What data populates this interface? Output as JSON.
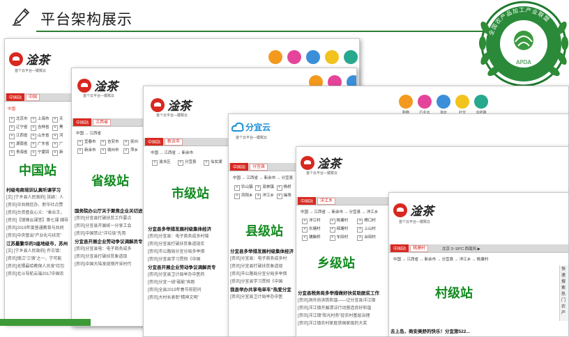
{
  "slide": {
    "title": "平台架构展示"
  },
  "brand": {
    "logo_text": "淦茶",
    "slogan": "首个云平台—键赋云"
  },
  "icon_labels": [
    "购物",
    "行业云",
    "淘云",
    "社交",
    "云终端"
  ],
  "icon_colors": [
    "#f39a1e",
    "#e4459a",
    "#3a8fd8",
    "#f2c31c",
    "#28a88c"
  ],
  "accent": "#d8281f",
  "label_color": "#128a1f",
  "stations": {
    "country": {
      "label": "中国站",
      "tag": "中国站",
      "select": "中国",
      "crumb_chip": "中国",
      "regions": [
        "北京市",
        "上海市",
        "天",
        "辽宁省",
        "吉林省",
        "黑",
        "江西省",
        "山东省",
        "河",
        "湖南省",
        "广东省",
        "广",
        "青海省",
        "宁夏回",
        "新"
      ],
      "news": [
        {
          "t": "h",
          "v": "村级电商培训认真听课学习"
        },
        {
          "t": "i",
          "v": "[文] [宁乡县人民政府] 张颖：人"
        },
        {
          "t": "i",
          "v": "[资讯]中共网信办、新华社点赞"
        },
        {
          "t": "i",
          "v": "[资讯]台资普会心义：“乘业王，"
        },
        {
          "t": "i",
          "v": "[资讯]【镇锋云课堂】第七课 辅导"
        },
        {
          "t": "i",
          "v": "[资讯]2019年度普通教育与共同"
        },
        {
          "t": "i",
          "v": "[资讯]中央管出“产业化与扶贫”"
        },
        {
          "t": "h",
          "v": "江苏最繁华的3座地级市，苏州"
        },
        {
          "t": "i",
          "v": "[文] [宁乡县人民政府] 乔古镇："
        },
        {
          "t": "i",
          "v": "[资讯]镇江“三强”之一，宁可能"
        },
        {
          "t": "i",
          "v": "[资讯]无锡最给教保人员发“红包"
        },
        {
          "t": "i",
          "v": "[资讯]北斗导航云端2017中国农"
        }
      ]
    },
    "province": {
      "label": "省级站",
      "tag": "中国站",
      "select": "江西省",
      "crumb": "中国 → 江西省",
      "regions": [
        "宜春市",
        "吉安市",
        "抚州",
        "新余市",
        "赣州市",
        "萍乡"
      ],
      "news": [
        {
          "t": "h",
          "v": "国务院办公厅关于聚焦企业关切进"
        },
        {
          "t": "i",
          "v": "[资讯]分宜县打破扶贫工作要点"
        },
        {
          "t": "i",
          "v": "[资讯]分宜县开展统一分享工会"
        },
        {
          "t": "i",
          "v": "[资讯]中国禁止“洋垃圾”先用"
        },
        {
          "t": "h",
          "v": "分宜县开展企业劳动争议调解员专"
        },
        {
          "t": "i",
          "v": "[资讯]分宜县电：电子商务成多"
        },
        {
          "t": "i",
          "v": "[资讯]分宜县打破扶贫象道现"
        },
        {
          "t": "i",
          "v": "[资讯]中国大陆发现钢开采时代"
        }
      ]
    },
    "city": {
      "label": "市级站",
      "tag": "中国站",
      "select": "新余市",
      "crumb": "中国 → 江西省 → 新余市",
      "regions": [
        "渝水区",
        "分宜县",
        "仙女湖"
      ],
      "news": [
        {
          "t": "h",
          "v": "分宜县多举措发展村级集体经济"
        },
        {
          "t": "i",
          "v": "[资讯]分宜县：电子商务成多村增"
        },
        {
          "t": "i",
          "v": "[资讯]分宜县打破扶贫象道现实"
        },
        {
          "t": "i",
          "v": "[资讯]市公路局分宜分局多举措"
        },
        {
          "t": "i",
          "v": "[资讯]分宜县学习贯彻《中国"
        },
        {
          "t": "h",
          "v": "分宜县开展企业劳动争议调解员专"
        },
        {
          "t": "i",
          "v": "[资讯]分宜县卫计局举办中医药"
        },
        {
          "t": "i",
          "v": "[资讯]分宜一线“磁能”奔跑"
        },
        {
          "t": "i",
          "v": "[资讯]全县2019年春节前慰问"
        },
        {
          "t": "i",
          "v": "[资讯]大村长表彰“精神文明”"
        }
      ]
    },
    "county": {
      "label": "县级站",
      "tag": "中国站",
      "select": "分宜县",
      "crumb": "中国 → 江西省 → 新余市 → 分宜县",
      "regions": [
        "钤山镇",
        "双林镇",
        "杨桥",
        "凤阳乡",
        "洋江乡",
        "操场"
      ],
      "news": [
        {
          "t": "h",
          "v": "分宜县多举措发展村级集体经济"
        },
        {
          "t": "i",
          "v": "[资讯]分宜县：电子商务成多村"
        },
        {
          "t": "i",
          "v": "[资讯]分宜县打破扶贫象道现"
        },
        {
          "t": "i",
          "v": "[资讯]市公路局分宜分局多举措"
        },
        {
          "t": "i",
          "v": "[资讯]分宜县学习贯彻《中国"
        },
        {
          "t": "h",
          "v": "我县举办共享电单车“热爱分宜"
        },
        {
          "t": "i",
          "v": "[资讯]分宜县卫计局举办中医"
        }
      ]
    },
    "town": {
      "label": "乡级站",
      "tag": "中国站",
      "select": "洋江乡",
      "crumb": "中国 → 江西省 → 新余市 → 分宜县 → 洋江乡",
      "regions": [
        "洋江村",
        "桃塘村",
        "樟口村",
        "长塘村",
        "碲塘村",
        "上山村",
        "铺脑桥",
        "车田村",
        "台田村"
      ],
      "news": [
        {
          "t": "h",
          "v": "分宜县税务局多举措做好扶贫助脱贫工作"
        },
        {
          "t": "i",
          "v": "[资讯]洞舟尚洪筑和谐——记分宜县洋江镇"
        },
        {
          "t": "i",
          "v": "[资讯]洋江镇开展清洁行动营造良好和谐"
        },
        {
          "t": "i",
          "v": "[资讯]洋江镇“阳光村务”促农村基层治理"
        },
        {
          "t": "i",
          "v": "[资讯]洋江镇农村家庭获国家级的大奖"
        }
      ]
    },
    "village": {
      "label": "村级站",
      "tag": "中国站",
      "select": "桃塘村",
      "crumb": "中国 → 江西省 → 新余市 → 分宜县 → 洋江乡 → 桃塘村",
      "weather": "北京 3~18°C 西南风 ▶",
      "side_text": "快速搜索热门农产",
      "news_bottom": "去上岛，商安美舒的快乐！分宜旅522..."
    }
  },
  "seal": {
    "ring_text": "全国农产品加工产业联盟",
    "abbr": "APDA"
  }
}
